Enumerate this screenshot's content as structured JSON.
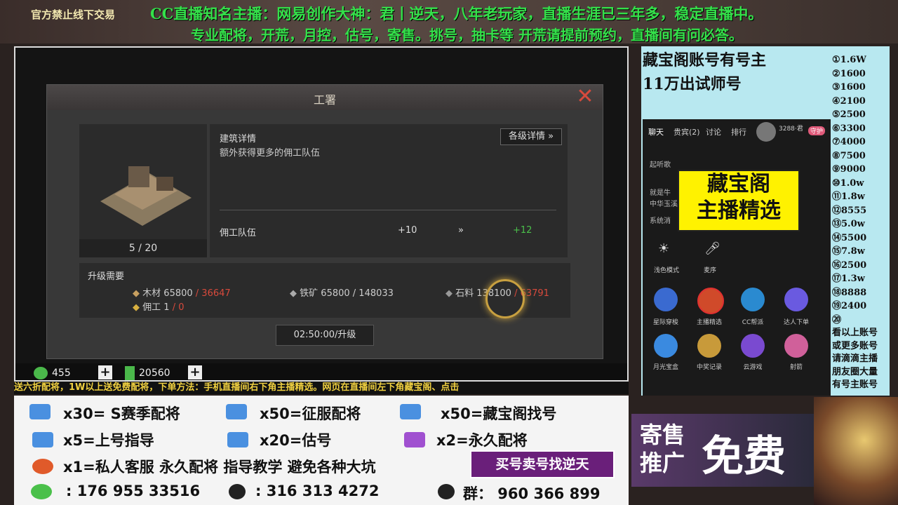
{
  "header": {
    "notice": "官方禁止线下交易",
    "line1": "CC直播知名主播：网易创作大神：君丨逆天，八年老玩家，直播生涯已三年多，稳定直播中。",
    "line2": "专业配将，开荒，月控，估号，寄售。挑号，抽卡等   开荒请提前预约，直播间有问必答。"
  },
  "dialog": {
    "title": "工署",
    "close": "✕",
    "building_level": "5 / 20",
    "detail_label": "建筑详情",
    "detail_btn": "各级详情 »",
    "detail_desc": "额外获得更多的佣工队伍",
    "stat_name": "佣工队伍",
    "stat_from": "+10",
    "stat_arrow": "»",
    "stat_to": "+12",
    "req_title": "升级需要",
    "wood": {
      "name": "木材",
      "have": "65800",
      "need": " / 36647"
    },
    "iron": {
      "name": "铁矿",
      "have": "65800",
      "need": " / 148033"
    },
    "stone": {
      "name": "石料",
      "have": "138100",
      "need": " / 63791"
    },
    "worker": {
      "name": "佣工",
      "have": "1",
      "need": " / 0"
    },
    "upgrade_btn": "02:50:00/升级"
  },
  "resources": {
    "jade": "455",
    "copper": "20560",
    "plus": "+"
  },
  "scroll_text": "送六折配将，1W以上送免费配将，下单方法：手机直播间右下角主播精选。网页在直播间左下角藏宝阁、点击",
  "promo": {
    "r1": [
      "x30= S赛季配将",
      "x50=征服配将",
      "x50=藏宝阁找号"
    ],
    "r2": [
      "x5=上号指导",
      "x20=估号",
      "x2=永久配将"
    ],
    "r3": "x1=私人客服 永久配将  指导教学 避免各种大坑",
    "buy": "买号卖号找逆天",
    "wechat": ": 176 955 33516",
    "qq": ":  316 313 4272",
    "group": "群： 960 366 899"
  },
  "side": {
    "h1": "藏宝阁账号有号主",
    "h2": "11万出试师号",
    "list": [
      "①1.6W",
      "②1600",
      "③1600",
      "④2100",
      "⑤2500",
      "⑥3300",
      "⑦4000",
      "⑧7500",
      "⑨9000",
      "⑩1.0w",
      "⑪1.8w",
      "⑫8555",
      "⑬5.0w",
      "⑭5500",
      "⑮7.8w",
      "⑯2500",
      "⑰1.3w",
      "⑱8888",
      "⑲2400",
      "⑳"
    ],
    "note": [
      "看以上账号",
      "或更多账号",
      "请滴滴主播",
      "朋友圈大量",
      "有号主账号"
    ],
    "tabs": [
      "聊天",
      "贵宾(2)",
      "讨论",
      "排行"
    ],
    "viewer": "3288·君",
    "guard": "守护",
    "chat": [
      "起听歌",
      "就是牛",
      "中华玉溪",
      "系统消"
    ],
    "yellow": [
      "藏宝阁",
      "主播精选"
    ],
    "row1": [
      "浅色模式",
      "麦序"
    ],
    "row2": [
      "星际穿梭",
      "主播精选",
      "CC帮派",
      "达人下单"
    ],
    "row3": [
      "月光宝盒",
      "中奖记录",
      "云游戏",
      "射箭"
    ]
  },
  "ad": {
    "left1": "寄售",
    "left2": "推广",
    "right": "免费"
  }
}
